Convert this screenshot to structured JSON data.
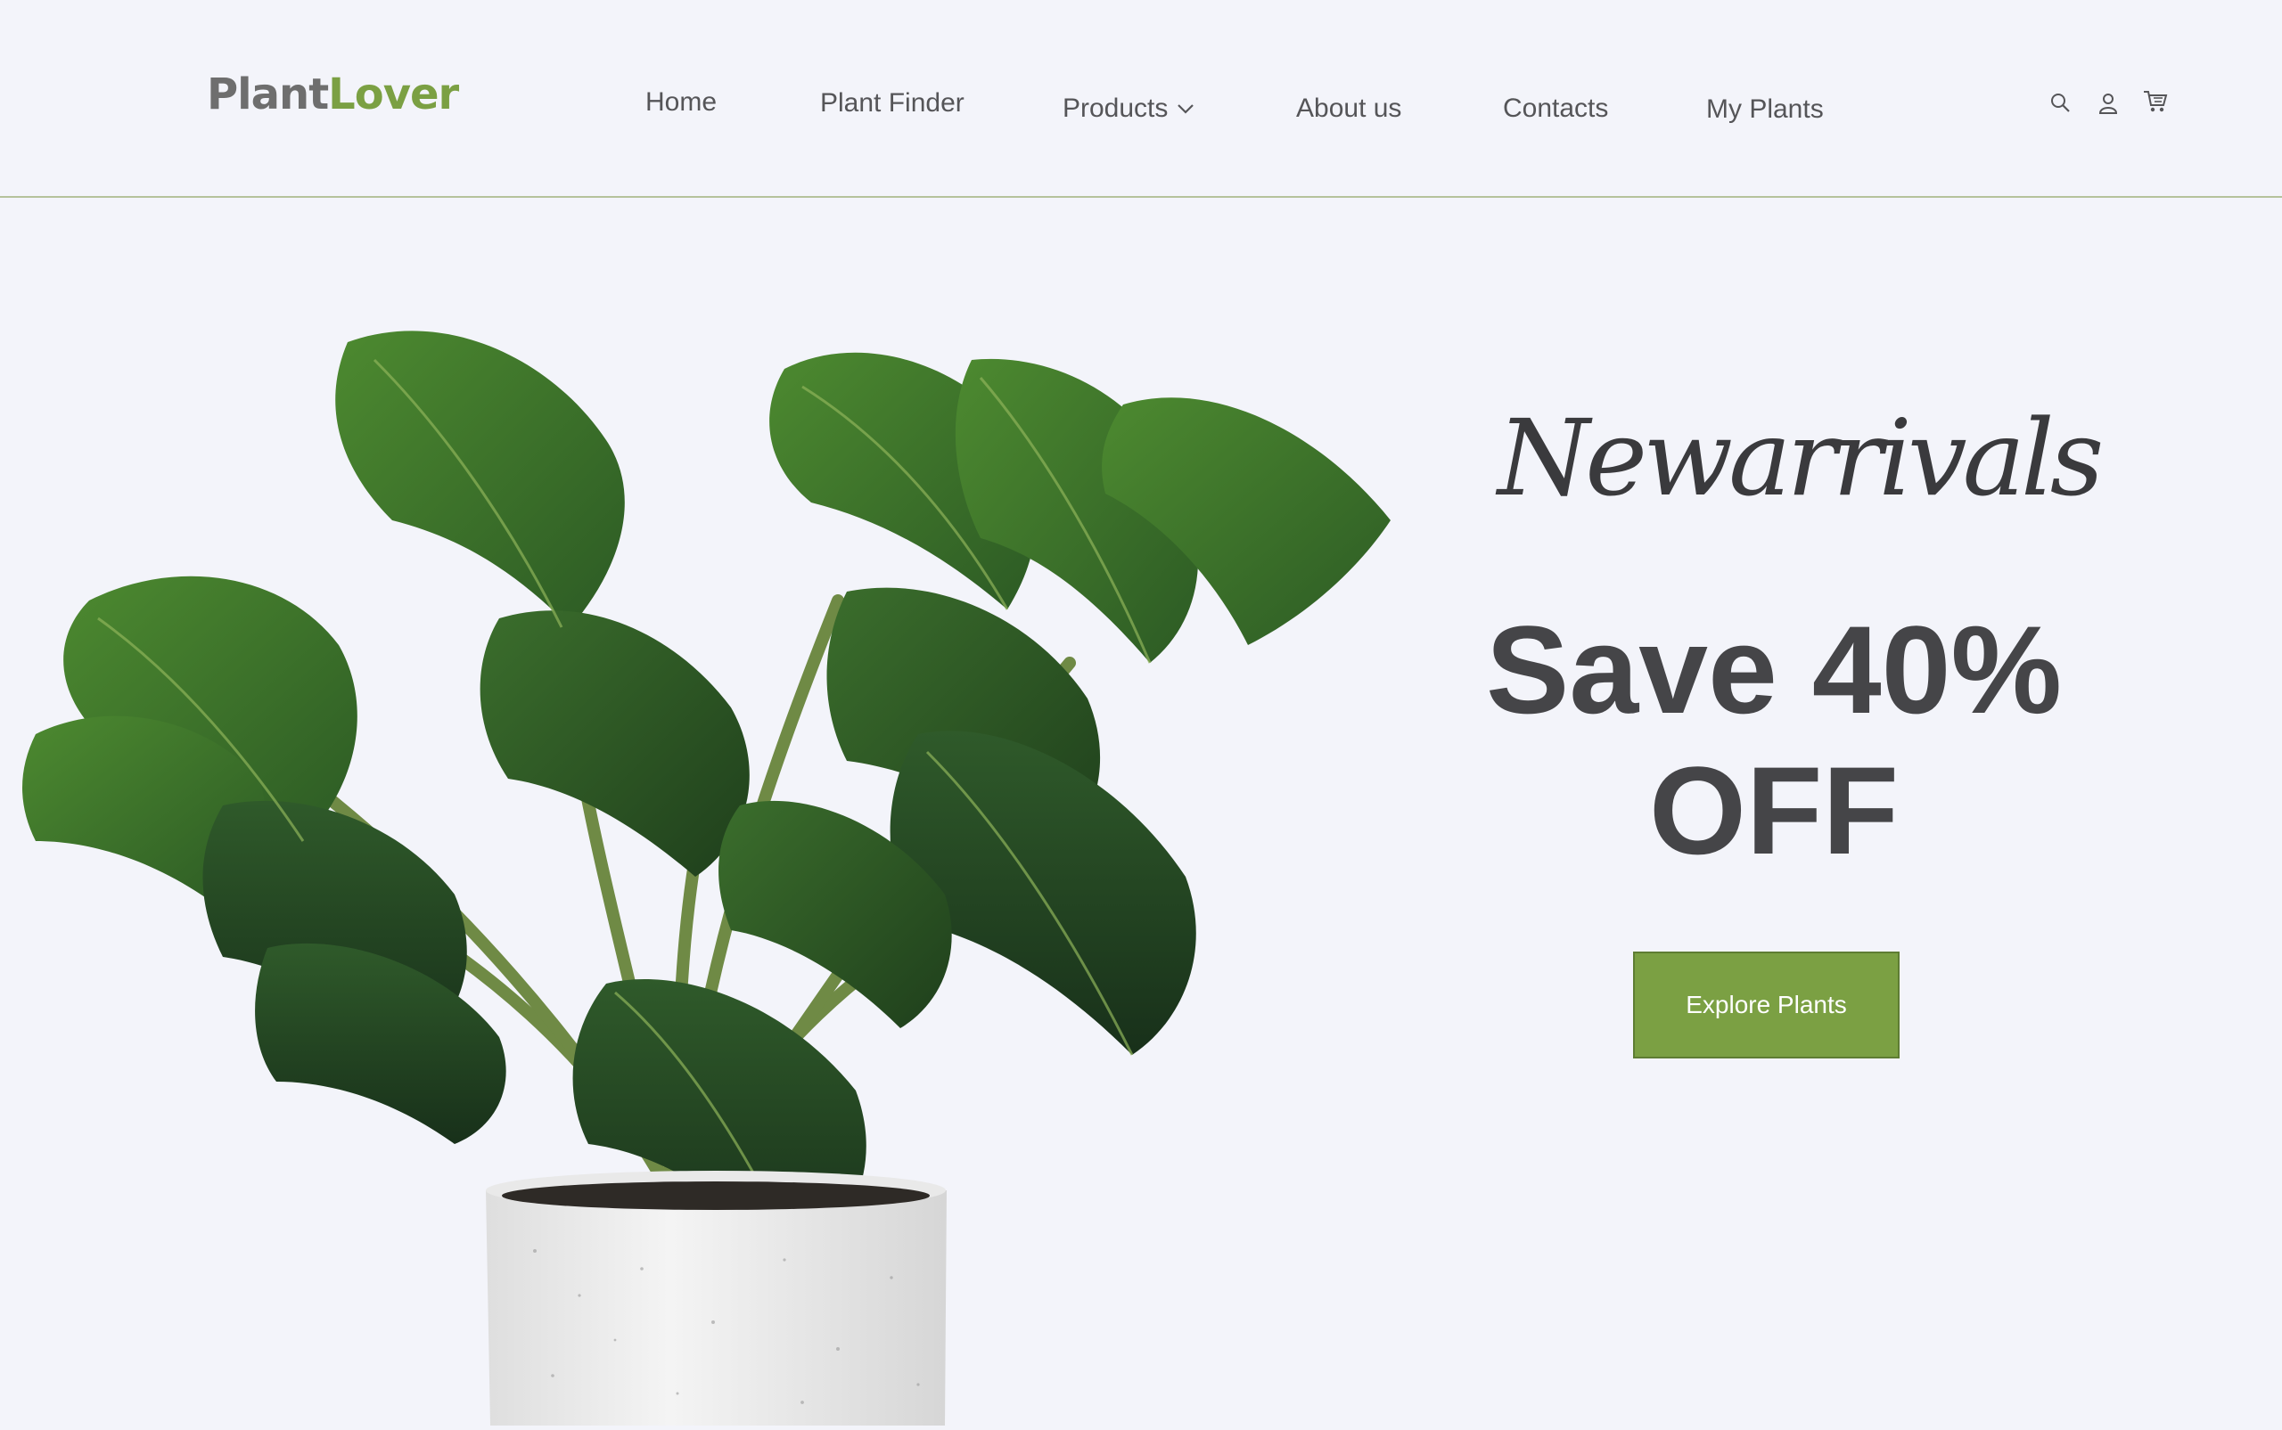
{
  "brand": {
    "name_part1": "Plant",
    "name_part2": "Lover"
  },
  "nav": {
    "home": "Home",
    "plant_finder": "Plant Finder",
    "products": "Products",
    "about": "About us",
    "contacts": "Contacts",
    "my_plants": "My Plants"
  },
  "header_icons": [
    "search-icon",
    "user-icon",
    "cart-icon"
  ],
  "hero": {
    "script_title": "Newarrivals",
    "headline_line1": "Save 40%",
    "headline_line2": "OFF",
    "cta_label": "Explore Plants"
  },
  "colors": {
    "accent": "#7ba043",
    "background": "#f3f4fa",
    "text_dark": "#454548",
    "divider": "#b5c29c"
  }
}
